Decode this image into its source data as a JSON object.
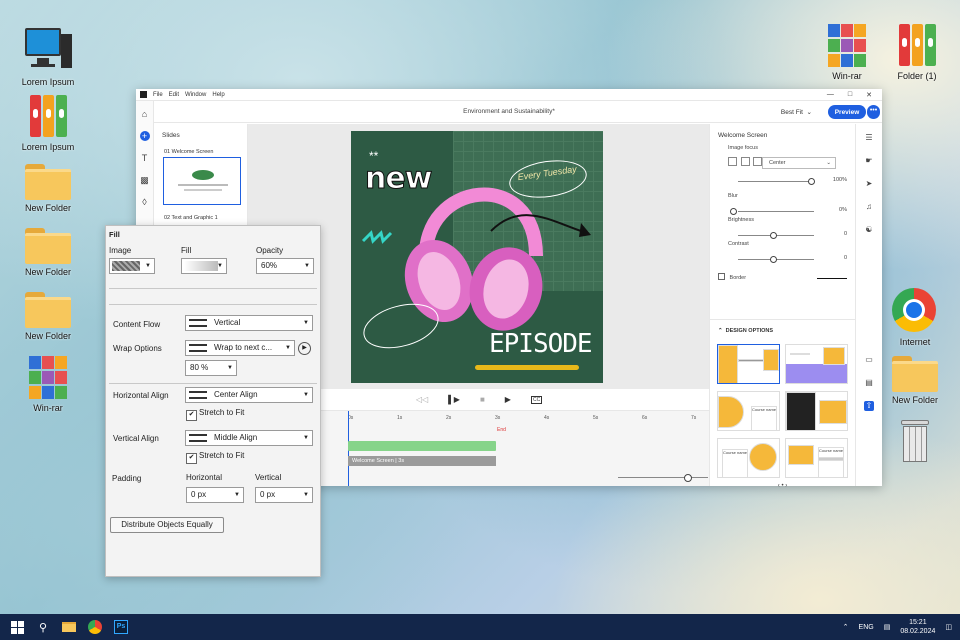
{
  "desktop": {
    "left_icons": [
      {
        "label": "Lorem Ipsum",
        "kind": "computer"
      },
      {
        "label": "Lorem Ipsum",
        "kind": "binders"
      },
      {
        "label": "New Folder",
        "kind": "folder"
      },
      {
        "label": "New Folder",
        "kind": "folder"
      },
      {
        "label": "New Folder",
        "kind": "folder"
      },
      {
        "label": "Win-rar",
        "kind": "winrar"
      }
    ],
    "right_icons": [
      {
        "label": "Win-rar",
        "kind": "winrar"
      },
      {
        "label": "Folder (1)",
        "kind": "binders"
      },
      {
        "label": "Internet",
        "kind": "chrome"
      },
      {
        "label": "New Folder",
        "kind": "folder"
      },
      {
        "label": "",
        "kind": "recycle-bin"
      }
    ]
  },
  "app": {
    "menu": [
      "File",
      "Edit",
      "Window",
      "Help"
    ],
    "doc_title": "Environment and Sustainability*",
    "best_fit": "Best Fit",
    "preview_label": "Preview",
    "more_label": "•••",
    "slides_header": "Slides",
    "slides": [
      {
        "caption": "01 Welcome Screen"
      },
      {
        "caption": "02 Text and Graphic 1"
      }
    ],
    "artboard": {
      "new_text": "new",
      "tuesday_text": "Every Tuesday",
      "episode_text": "EPISODE",
      "stars": "**"
    },
    "timeline": {
      "ticks": [
        "0s",
        "1s",
        "2s",
        "3s",
        "4s",
        "5s",
        "6s",
        "7s"
      ],
      "end_label": "End",
      "clip_label": "Welcome Screen | 3s"
    },
    "props": {
      "title": "Welcome Screen",
      "image_focus_label": "Image focus",
      "focus_value": "Center",
      "opacity_value": "100%",
      "blur_label": "Blur",
      "blur_value": "0%",
      "brightness_label": "Brightness",
      "brightness_value": "0",
      "contrast_label": "Contrast",
      "contrast_value": "0",
      "border_label": "Border",
      "design_options_label": "DESIGN OPTIONS",
      "course_name": "Course name",
      "pager": "‹ • ›"
    }
  },
  "fill_panel": {
    "title": "Fill",
    "image_label": "Image",
    "fill_label": "Fill",
    "opacity_label": "Opacity",
    "opacity_value": "60%",
    "content_flow_label": "Content Flow",
    "content_flow_value": "Vertical",
    "wrap_options_label": "Wrap Options",
    "wrap_value": "Wrap to next c...",
    "wrap_percent": "80 %",
    "h_align_label": "Horizontal Align",
    "h_align_value": "Center Align",
    "stretch_label_1": "Stretch to Fit",
    "v_align_label": "Vertical Align",
    "v_align_value": "Middle Align",
    "stretch_label_2": "Stretch to Fit",
    "padding_label": "Padding",
    "horizontal_label": "Horizontal",
    "vertical_label": "Vertical",
    "pad_h_value": "0 px",
    "pad_v_value": "0 px",
    "distribute_label": "Distribute Objects Equally"
  },
  "taskbar": {
    "lang": "ENG",
    "time": "15:21",
    "date": "08.02.2024"
  }
}
